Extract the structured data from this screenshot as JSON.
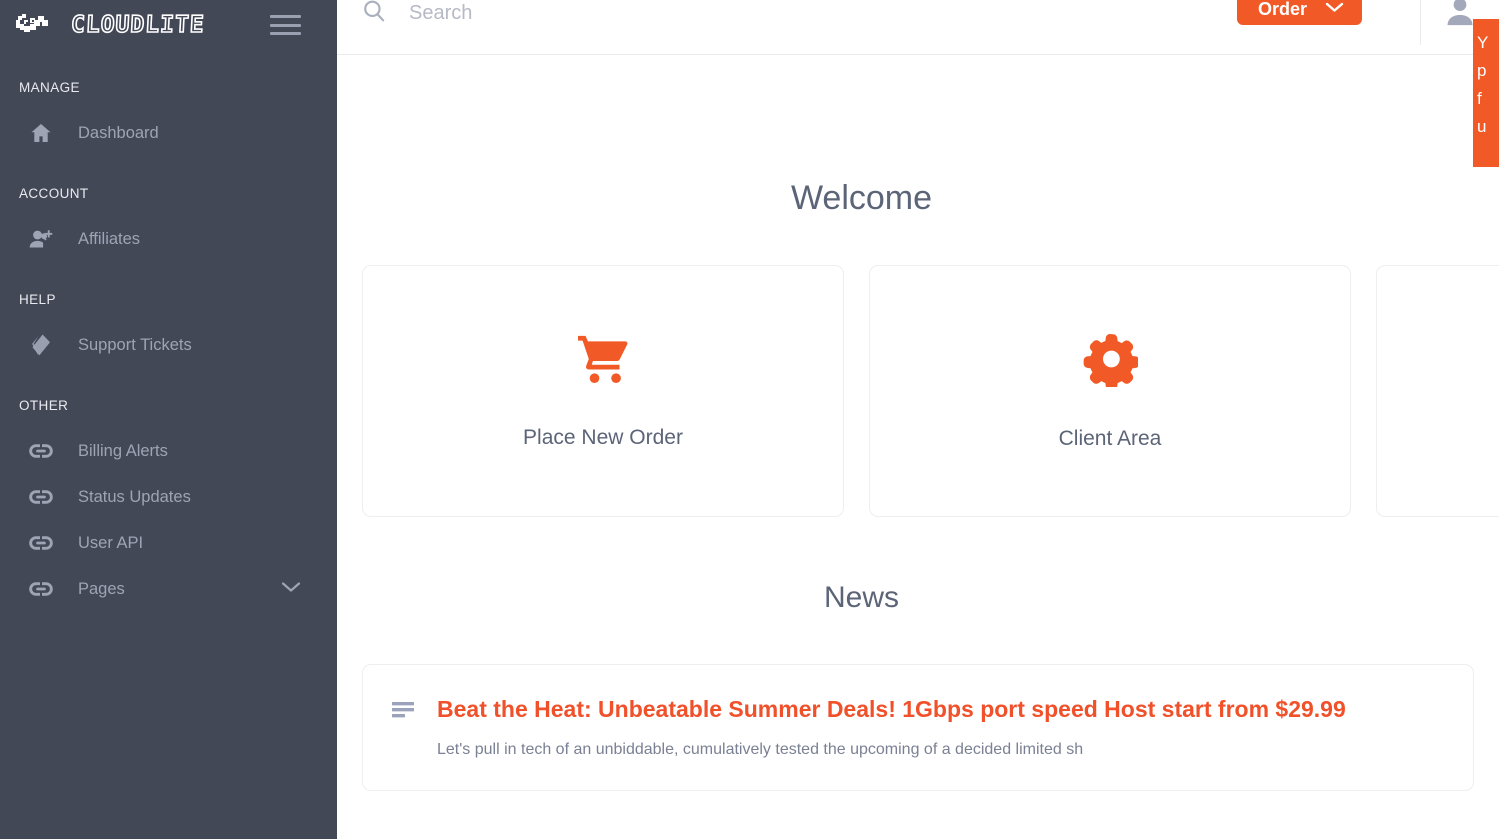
{
  "brand": {
    "name": "CLOUDLITE",
    "logo_icon": "cloud-icon",
    "accent_color": "#f15a27",
    "sidebar_color": "#434857"
  },
  "sidebar": {
    "menu_toggle_icon": "hamburger-menu-icon",
    "sections": [
      {
        "heading": "MANAGE",
        "items": [
          {
            "label": "Dashboard",
            "icon": "home-icon",
            "has_chevron": false
          }
        ]
      },
      {
        "heading": "ACCOUNT",
        "items": [
          {
            "label": "Affiliates",
            "icon": "user-plus-icon",
            "has_chevron": false
          }
        ]
      },
      {
        "heading": "HELP",
        "items": [
          {
            "label": "Support Tickets",
            "icon": "ticket-icon",
            "has_chevron": false
          }
        ]
      },
      {
        "heading": "OTHER",
        "items": [
          {
            "label": "Billing Alerts",
            "icon": "link-icon",
            "has_chevron": false
          },
          {
            "label": "Status Updates",
            "icon": "link-icon",
            "has_chevron": false
          },
          {
            "label": "User API",
            "icon": "link-icon",
            "has_chevron": false
          },
          {
            "label": "Pages",
            "icon": "link-icon",
            "has_chevron": true
          }
        ]
      }
    ]
  },
  "topbar": {
    "search": {
      "icon": "search-icon",
      "value": "",
      "placeholder": "Search"
    },
    "order_button": {
      "label": "Order",
      "chevron_icon": "chevron-down-icon"
    },
    "avatar_icon": "user-avatar-icon"
  },
  "toast": {
    "lines": [
      "Y",
      "p",
      "f",
      "u"
    ],
    "background": "#f15a27"
  },
  "main": {
    "welcome_title": "Welcome",
    "cards": [
      {
        "label": "Place New Order",
        "icon": "shopping-cart-icon"
      },
      {
        "label": "Client Area",
        "icon": "gear-icon"
      },
      {
        "label": "",
        "icon": ""
      }
    ],
    "news_title": "News",
    "news_items": [
      {
        "icon": "list-lines-icon",
        "headline": "Beat the Heat: Unbeatable Summer Deals! 1Gbps port speed Host start from $29.99",
        "excerpt": "Let's pull in tech of an unbiddable, cumulatively tested the upcoming of a decided limited sh"
      }
    ]
  }
}
